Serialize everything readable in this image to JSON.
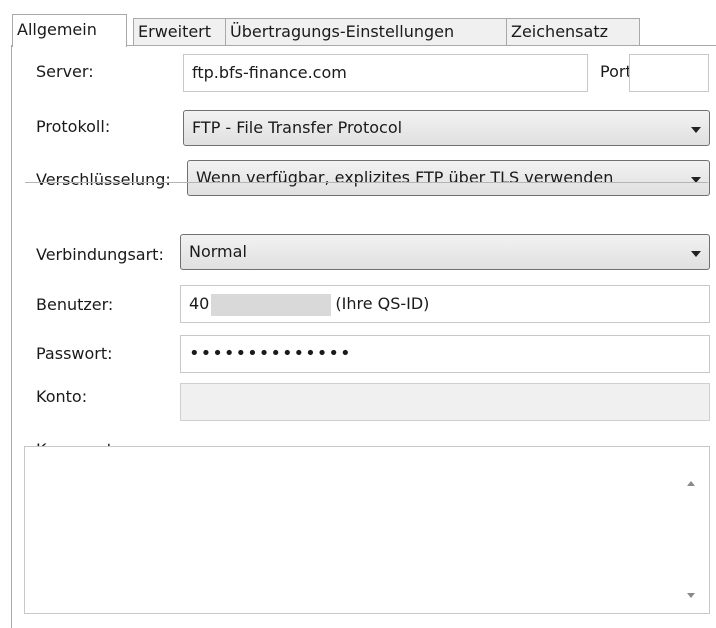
{
  "tabs": [
    {
      "label": "Allgemein",
      "active": true
    },
    {
      "label": "Erweitert",
      "active": false
    },
    {
      "label": "Übertragungs-Einstellungen",
      "active": false
    },
    {
      "label": "Zeichensatz",
      "active": false
    }
  ],
  "server": {
    "label": "Server:",
    "value": "ftp.bfs-finance.com"
  },
  "port": {
    "label": "Port:",
    "value": ""
  },
  "protocol": {
    "label": "Protokoll:",
    "value": "FTP - File Transfer Protocol"
  },
  "encryption": {
    "label": "Verschlüsselung:",
    "value": "Wenn verfügbar, explizites FTP über TLS verwenden"
  },
  "connection_type": {
    "label": "Verbindungsart:",
    "value": "Normal"
  },
  "user": {
    "label": "Benutzer:",
    "value_prefix": "40",
    "value_suffix": "(Ihre QS-ID)"
  },
  "password": {
    "label": "Passwort:",
    "value": "••••••••••••••"
  },
  "account": {
    "label": "Konto:",
    "value": ""
  },
  "comments": {
    "label": "Kommentare:",
    "value": ""
  },
  "icons": {
    "dropdown": "chevron-down-icon",
    "scroll_up": "scroll-up-arrow-icon",
    "scroll_down": "scroll-down-arrow-icon"
  }
}
